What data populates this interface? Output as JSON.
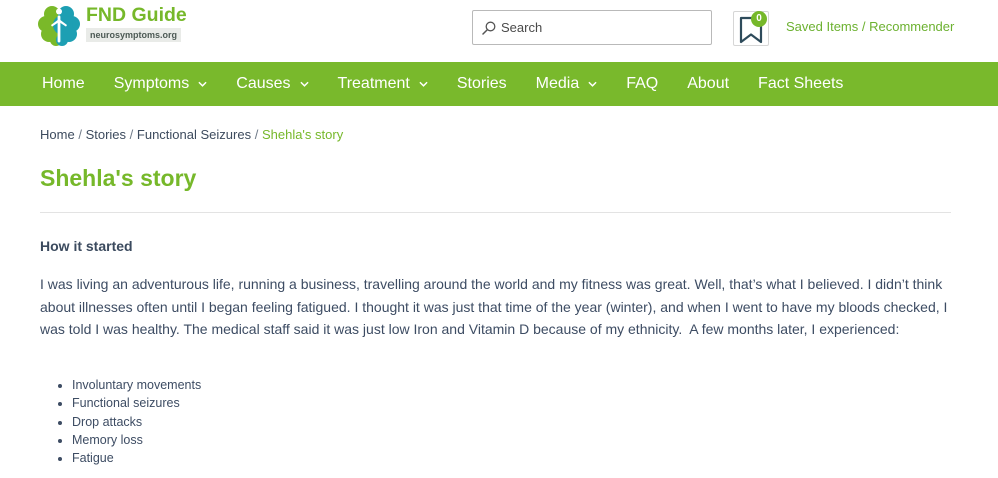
{
  "header": {
    "logo": {
      "icon": "brain-logo-icon",
      "title": "FND Guide",
      "subtitle": "neurosymptoms.org"
    },
    "search": {
      "icon": "search-icon",
      "placeholder": "Search"
    },
    "saved_items": {
      "icon": "bookmark-icon",
      "count": "0",
      "link_label": "Saved Items / Recommender"
    }
  },
  "nav": {
    "dropdown_icon": "chevron-down-icon",
    "items": [
      {
        "label": "Home",
        "has_dropdown": false
      },
      {
        "label": "Symptoms",
        "has_dropdown": true
      },
      {
        "label": "Causes",
        "has_dropdown": true
      },
      {
        "label": "Treatment",
        "has_dropdown": true
      },
      {
        "label": "Stories",
        "has_dropdown": false
      },
      {
        "label": "Media",
        "has_dropdown": true
      },
      {
        "label": "FAQ",
        "has_dropdown": false
      },
      {
        "label": "About",
        "has_dropdown": false
      },
      {
        "label": "Fact Sheets",
        "has_dropdown": false
      }
    ]
  },
  "breadcrumb": {
    "links": [
      "Home",
      "Stories",
      "Functional Seizures"
    ],
    "separator": "/",
    "current": "Shehla's story"
  },
  "article": {
    "title": "Shehla's story",
    "section_heading": "How it started",
    "paragraph": "I was living an adventurous life, running a business, travelling around the world and my fitness was great. Well, that’s what I believed. I didn’t think about illnesses often until I began feeling fatigued. I thought it was just that time of the year (winter), and when I went to have my bloods checked, I was told I was healthy. The medical staff said it was just low Iron and Vitamin D because of my ethnicity.  A few months later, I experienced:",
    "list": [
      "Involuntary movements",
      "Functional seizures",
      "Drop attacks",
      "Memory loss",
      "Fatigue"
    ]
  },
  "colors": {
    "brand_green": "#76b82a",
    "nav_background": "#79b92c",
    "link_green": "#6cb130",
    "text": "#3d4c63",
    "logo_teal": "#1d9fb3",
    "bookmark_icon": "#2e4b5b"
  }
}
